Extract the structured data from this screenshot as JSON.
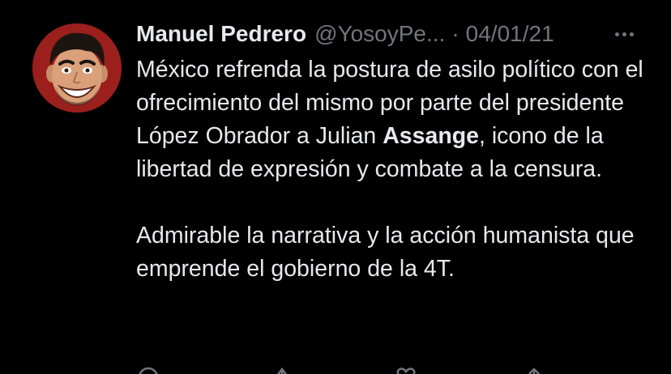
{
  "tweet": {
    "display_name": "Manuel Pedrero",
    "handle": "@YosoyPe...",
    "separator": "·",
    "date": "04/01/21",
    "paragraph1": {
      "part1": "México refrenda la postura de asilo político con el ofrecimiento del mismo por parte del presidente López Obrador a Julian ",
      "mention": "Assange",
      "part2": ", icono de la libertad de expresión y combate a la censura."
    },
    "paragraph2": "Admirable la narrativa y la acción humanista que emprende el gobierno de la 4T."
  },
  "icons": {
    "more": "more-options-icon",
    "reply": "reply-icon",
    "retweet": "retweet-icon",
    "like": "like-icon",
    "share": "share-icon"
  },
  "colors": {
    "background": "#000000",
    "text_primary": "#e7e9ea",
    "text_secondary": "#71767b",
    "avatar_background": "#9b1f1c"
  }
}
